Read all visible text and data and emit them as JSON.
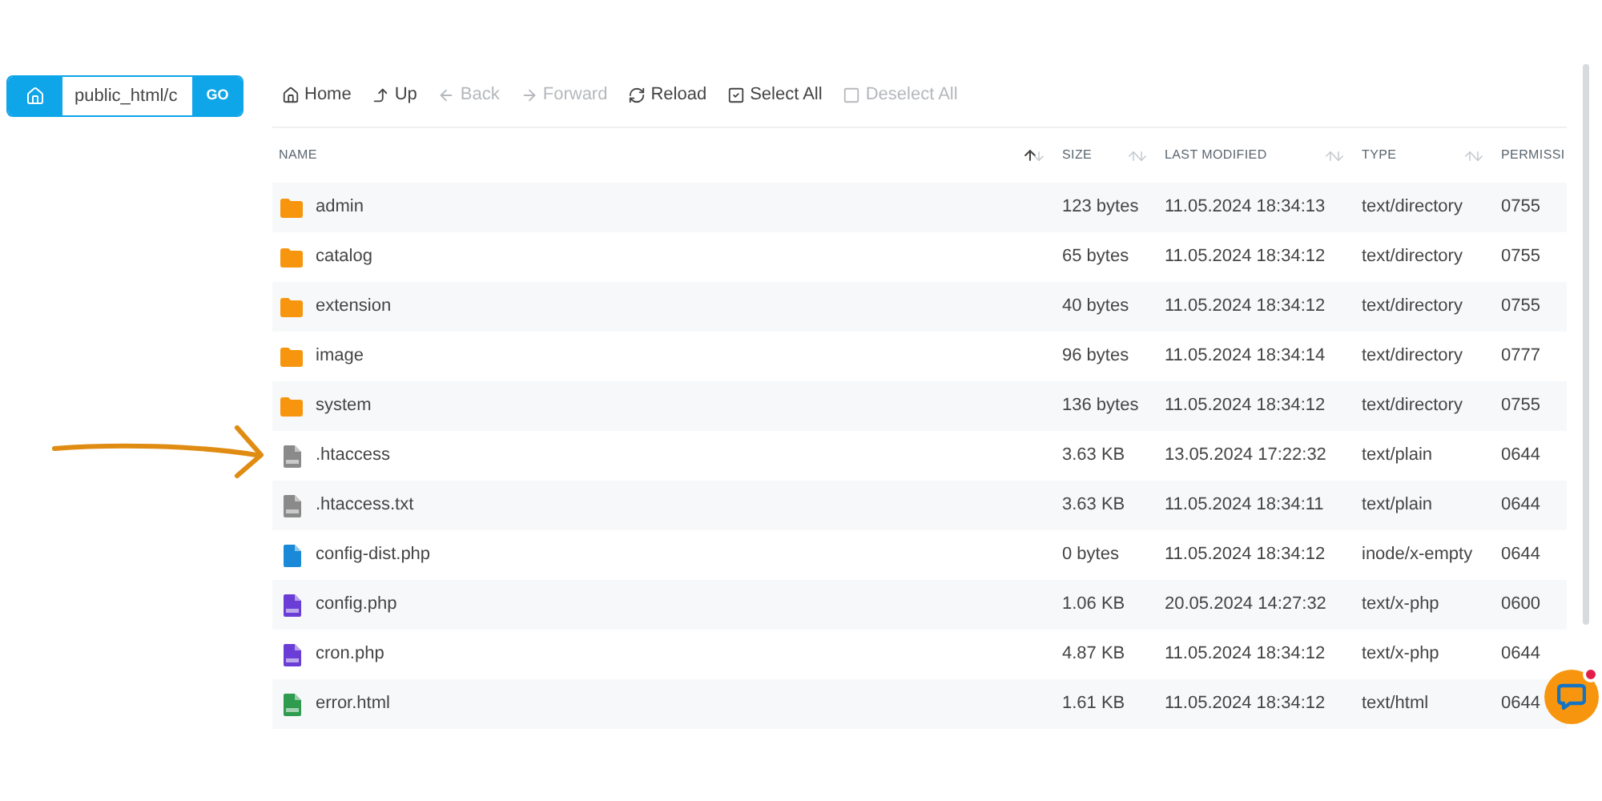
{
  "path_bar": {
    "value": "public_html/c",
    "go": "GO"
  },
  "toolbar": [
    {
      "label": "Home",
      "disabled": false
    },
    {
      "label": "Up",
      "disabled": false
    },
    {
      "label": "Back",
      "disabled": true
    },
    {
      "label": "Forward",
      "disabled": true
    },
    {
      "label": "Reload",
      "disabled": false
    },
    {
      "label": "Select All",
      "disabled": false
    },
    {
      "label": "Deselect All",
      "disabled": true
    }
  ],
  "table": {
    "columns": [
      {
        "label": "NAME",
        "sorted": true
      },
      {
        "label": "SIZE",
        "sorted": false
      },
      {
        "label": "LAST MODIFIED",
        "sorted": false
      },
      {
        "label": "TYPE",
        "sorted": false
      },
      {
        "label": "PERMISSI"
      }
    ],
    "rows": [
      {
        "kind": "folder",
        "name": "admin",
        "size": "123 bytes",
        "modified": "11.05.2024 18:34:13",
        "type": "text/directory",
        "perms": "0755"
      },
      {
        "kind": "folder",
        "name": "catalog",
        "size": "65 bytes",
        "modified": "11.05.2024 18:34:12",
        "type": "text/directory",
        "perms": "0755"
      },
      {
        "kind": "folder",
        "name": "extension",
        "size": "40 bytes",
        "modified": "11.05.2024 18:34:12",
        "type": "text/directory",
        "perms": "0755"
      },
      {
        "kind": "folder",
        "name": "image",
        "size": "96 bytes",
        "modified": "11.05.2024 18:34:14",
        "type": "text/directory",
        "perms": "0777"
      },
      {
        "kind": "folder",
        "name": "system",
        "size": "136 bytes",
        "modified": "11.05.2024 18:34:12",
        "type": "text/directory",
        "perms": "0755"
      },
      {
        "kind": "text",
        "name": ".htaccess",
        "size": "3.63 KB",
        "modified": "13.05.2024 17:22:32",
        "type": "text/plain",
        "perms": "0644"
      },
      {
        "kind": "text",
        "name": ".htaccess.txt",
        "size": "3.63 KB",
        "modified": "11.05.2024 18:34:11",
        "type": "text/plain",
        "perms": "0644"
      },
      {
        "kind": "file",
        "name": "config-dist.php",
        "size": "0 bytes",
        "modified": "11.05.2024 18:34:12",
        "type": "inode/x-empty",
        "perms": "0644"
      },
      {
        "kind": "php",
        "name": "config.php",
        "size": "1.06 KB",
        "modified": "20.05.2024 14:27:32",
        "type": "text/x-php",
        "perms": "0600"
      },
      {
        "kind": "php",
        "name": "cron.php",
        "size": "4.87 KB",
        "modified": "11.05.2024 18:34:12",
        "type": "text/x-php",
        "perms": "0644"
      },
      {
        "kind": "html",
        "name": "error.html",
        "size": "1.61 KB",
        "modified": "11.05.2024 18:34:12",
        "type": "text/html",
        "perms": "0644"
      }
    ]
  },
  "chat": {
    "unread": true
  }
}
